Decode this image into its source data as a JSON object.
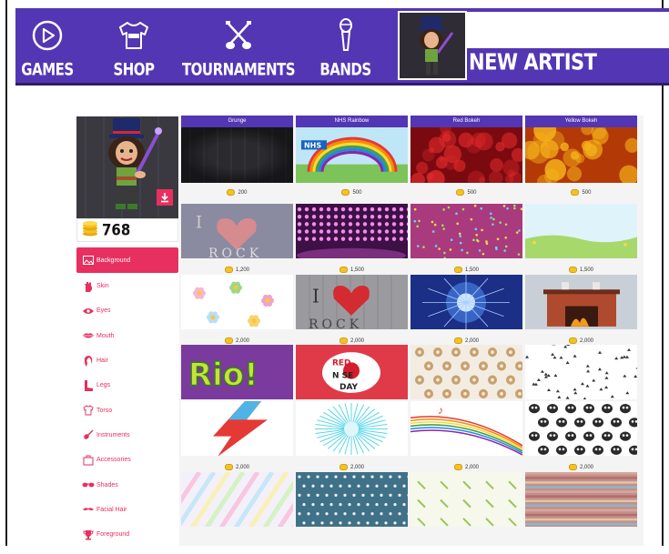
{
  "nav": {
    "games": "GAMES",
    "shop": "SHOP",
    "tournaments": "TOURNAMENTS",
    "bands": "BANDS",
    "artist_name": "NEW ARTIST"
  },
  "colors": {
    "brand": "#5336b3",
    "accent": "#e72f60",
    "coin": "#f3c322"
  },
  "player": {
    "coins": "768"
  },
  "menu": [
    {
      "label": "Background",
      "icon": "image-icon",
      "active": true
    },
    {
      "label": "Skin",
      "icon": "hand-icon"
    },
    {
      "label": "Eyes",
      "icon": "eye-icon"
    },
    {
      "label": "Mouth",
      "icon": "lips-icon"
    },
    {
      "label": "Hair",
      "icon": "hair-icon"
    },
    {
      "label": "Legs",
      "icon": "boot-icon"
    },
    {
      "label": "Torso",
      "icon": "shirt-icon"
    },
    {
      "label": "Instruments",
      "icon": "guitar-icon"
    },
    {
      "label": "Accessories",
      "icon": "bag-icon"
    },
    {
      "label": "Shades",
      "icon": "sunglasses-icon"
    },
    {
      "label": "Facial Hair",
      "icon": "mustache-icon"
    },
    {
      "label": "Foreground",
      "icon": "trophy-icon"
    }
  ],
  "tiles": [
    {
      "title": "Grunge",
      "price": "200",
      "art": "grunge"
    },
    {
      "title": "NHS Rainbow",
      "price": "500",
      "art": "nhs"
    },
    {
      "title": "Red Bokeh",
      "price": "500",
      "art": "redbokeh"
    },
    {
      "title": "Yellow Bokeh",
      "price": "500",
      "art": "yellowbokeh"
    },
    {
      "title": "",
      "price": "1,200",
      "art": "heartrock"
    },
    {
      "title": "",
      "price": "1,500",
      "art": "stage"
    },
    {
      "title": "",
      "price": "1,500",
      "art": "pinkdots"
    },
    {
      "title": "",
      "price": "1,500",
      "art": "meadow"
    },
    {
      "title": "",
      "price": "2,000",
      "art": "flowers"
    },
    {
      "title": "",
      "price": "2,000",
      "art": "ilikerock"
    },
    {
      "title": "",
      "price": "2,000",
      "art": "bluestar"
    },
    {
      "title": "",
      "price": "2,000",
      "art": "fireplace"
    },
    {
      "title": "",
      "price": "2,000",
      "art": "rio"
    },
    {
      "title": "",
      "price": "2,000",
      "art": "rednose"
    },
    {
      "title": "",
      "price": "2,000",
      "art": "donuts"
    },
    {
      "title": "",
      "price": "2,000",
      "art": "blackdots"
    },
    {
      "title": "",
      "price": "2,000",
      "art": "bolt"
    },
    {
      "title": "",
      "price": "2,000",
      "art": "burst"
    },
    {
      "title": "",
      "price": "2,000",
      "art": "notes"
    },
    {
      "title": "",
      "price": "2,000",
      "art": "skulls"
    },
    {
      "title": "",
      "price": null,
      "art": "pastel"
    },
    {
      "title": "",
      "price": null,
      "art": "dots"
    },
    {
      "title": "",
      "price": null,
      "art": "guitars"
    },
    {
      "title": "",
      "price": null,
      "art": "stripes"
    }
  ],
  "row_prices_bottom": [
    "2,000",
    "2,000",
    "2,000",
    "2,000"
  ],
  "row_prices_top": [
    "200",
    "500",
    "500",
    "500"
  ]
}
